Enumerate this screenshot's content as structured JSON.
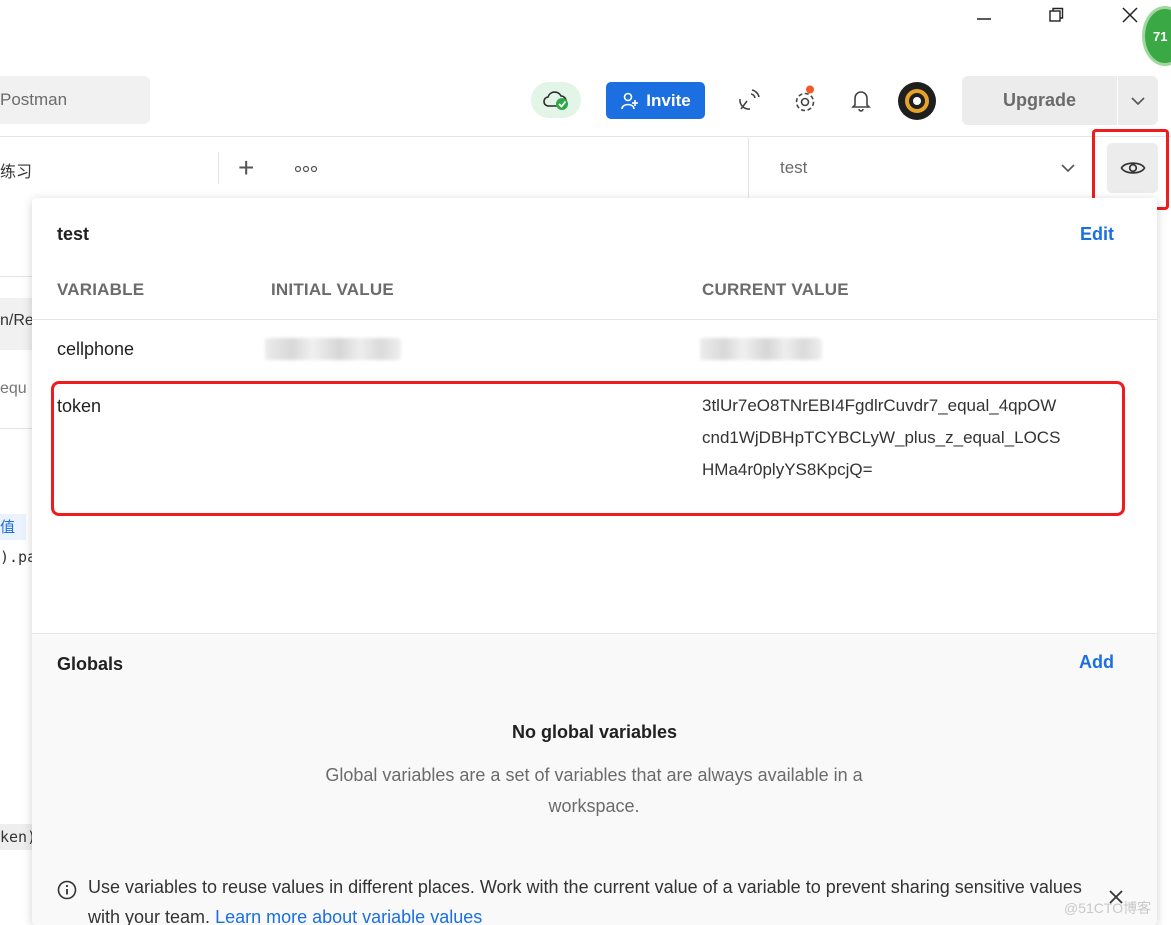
{
  "window": {
    "notification_count": "71"
  },
  "header": {
    "search_placeholder": "Postman",
    "invite_label": "Invite",
    "upgrade_label": "Upgrade",
    "colors": {
      "invite": "#1b6fe0",
      "sync_ok": "#2ea84a",
      "settings_dot": "#f15a24"
    }
  },
  "tabs": {
    "active_tab_label": "练习",
    "environment_selected": "test"
  },
  "behind_fragments": {
    "line1": "n/Re",
    "line2": "equ",
    "line3": "值",
    "line4": ").pa",
    "line5": "ken)"
  },
  "env_popover": {
    "env_title": "test",
    "edit_label": "Edit",
    "columns": [
      "VARIABLE",
      "INITIAL VALUE",
      "CURRENT VALUE"
    ],
    "rows": [
      {
        "variable": "cellphone",
        "initial_value": "",
        "current_value": ""
      },
      {
        "variable": "token",
        "initial_value": "",
        "current_value": "3tlUr7eO8TNrEBI4FgdlrCuvdr7_equal_4qpOWcnd1WjDBHpTCYBCLyW_plus_z_equal_LOCSHMa4r0plyYS8KpcjQ="
      }
    ],
    "token_lines": [
      "3tlUr7eO8TNrEBI4FgdlrCuvdr7_equal_4qpOW",
      "cnd1WjDBHpTCYBCLyW_plus_z_equal_LOCS",
      "HMa4r0plyYS8KpcjQ="
    ]
  },
  "globals": {
    "title": "Globals",
    "add_label": "Add",
    "empty_title": "No global variables",
    "empty_description": "Global variables are a set of variables that are always available in a workspace."
  },
  "info_banner": {
    "text": "Use variables to reuse values in different places. Work with the current value of a variable to prevent sharing sensitive values with your team.",
    "link_text": "Learn more about variable values"
  },
  "watermark": "@51CTO博客"
}
